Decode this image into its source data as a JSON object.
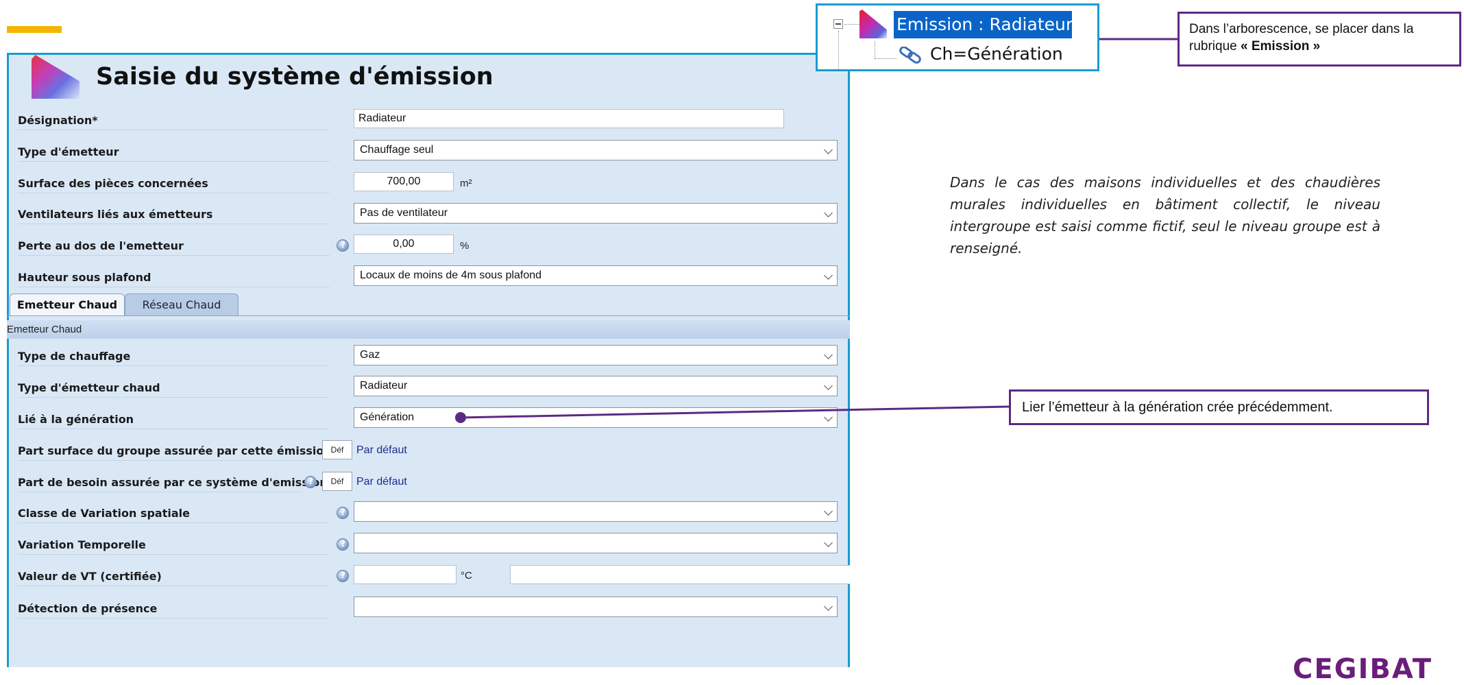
{
  "form": {
    "title": "Saisie du système d'émission",
    "fields": [
      {
        "label": "Désignation*",
        "value": "Radiateur"
      },
      {
        "label": "Type d'émetteur",
        "value": "Chauffage seul"
      },
      {
        "label": "Surface des pièces concernées",
        "value": "700,00",
        "unit": "m²"
      },
      {
        "label": "Ventilateurs liés aux émetteurs",
        "value": "Pas de ventilateur"
      },
      {
        "label": "Perte au dos de l'emetteur",
        "value": "0,00",
        "unit": "%"
      },
      {
        "label": "Hauteur sous plafond",
        "value": "Locaux de moins de 4m sous plafond"
      }
    ],
    "tabs": [
      {
        "label": "Emetteur Chaud",
        "active": true
      },
      {
        "label": "Réseau Chaud",
        "active": false
      }
    ],
    "section_header": "Emetteur Chaud",
    "section_fields": [
      {
        "label": "Type de chauffage",
        "value": "Gaz"
      },
      {
        "label": "Type d'émetteur chaud",
        "value": "Radiateur"
      },
      {
        "label": "Lié à la génération",
        "value": "Génération"
      },
      {
        "label": "Part surface du groupe assurée par cette émission",
        "button": "Déf",
        "value": "Par défaut"
      },
      {
        "label": "Part de besoin assurée par ce système d'emission",
        "button": "Déf",
        "value": "Par défaut"
      },
      {
        "label": "Classe de Variation spatiale",
        "value": ""
      },
      {
        "label": "Variation Temporelle",
        "value": ""
      },
      {
        "label": "Valeur de VT (certifiée)",
        "value": "",
        "unit": "°C"
      },
      {
        "label": "Détection de présence",
        "value": ""
      }
    ]
  },
  "tree": {
    "selected": "Emission : Radiateur",
    "child": "Ch=Génération"
  },
  "callouts": {
    "tree_hint_normal": "Dans l’arborescence, se placer dans la rubrique ",
    "tree_hint_bold": "« Emission »",
    "link_hint": "Lier l’émetteur à la génération crée précédemment."
  },
  "note": "Dans le cas des maisons individuelles et des chaudières murales individuelles en bâtiment collectif, le niveau intergroupe est saisi comme fictif, seul le niveau groupe est à renseigné.",
  "colors": {
    "panel_border": "#1a9bd1",
    "panel_bg": "#dae8f6",
    "callout_border": "#5b2a82",
    "accent_bar": "#f4b400",
    "tree_selection": "#0a64c8"
  }
}
